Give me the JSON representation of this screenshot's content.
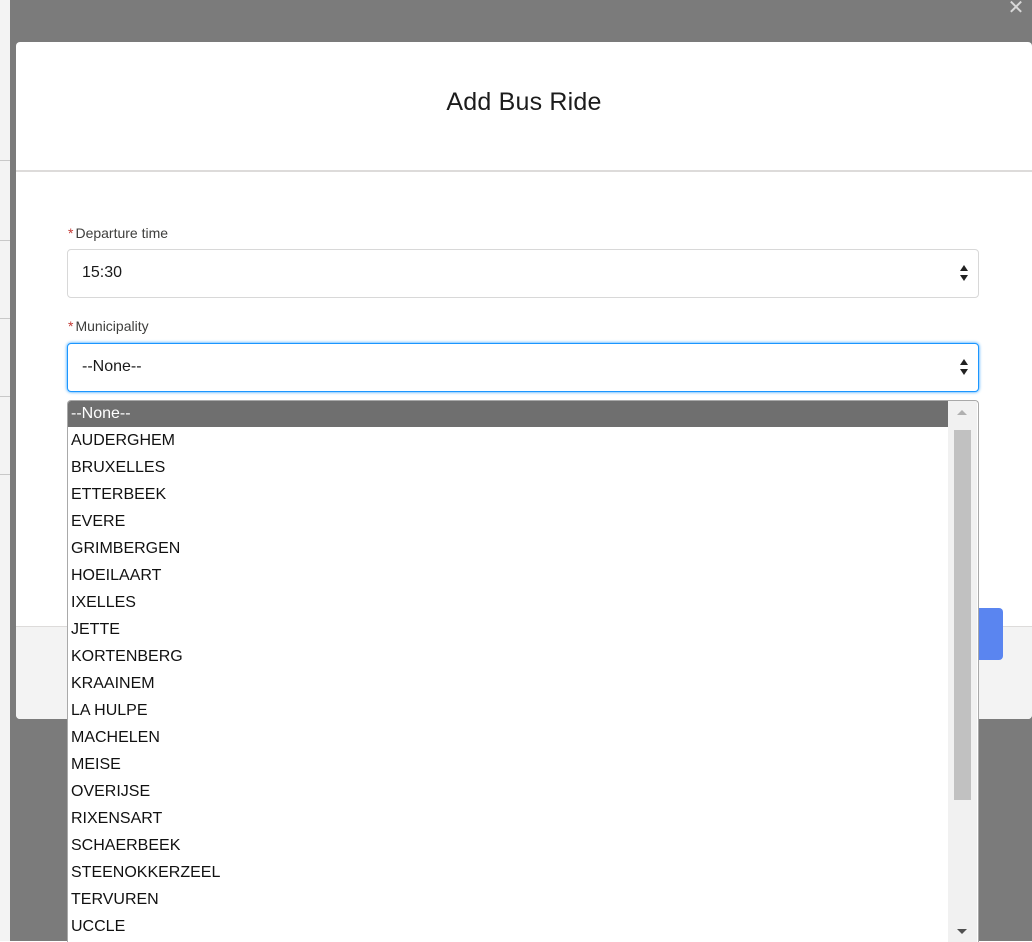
{
  "modal": {
    "title": "Add Bus Ride",
    "close_glyph": "✕"
  },
  "form": {
    "required_marker": "*",
    "departure_label": "Departure time",
    "departure_value": "15:30",
    "municipality_label": "Municipality",
    "municipality_value": "--None--"
  },
  "dropdown": {
    "selected_index": 0,
    "options": [
      "--None--",
      "AUDERGHEM",
      "BRUXELLES",
      "ETTERBEEK",
      "EVERE",
      "GRIMBERGEN",
      "HOEILAART",
      "IXELLES",
      "JETTE",
      "KORTENBERG",
      "KRAAINEM",
      "LA HULPE",
      "MACHELEN",
      "MEISE",
      "OVERIJSE",
      "RIXENSART",
      "SCHAERBEEK",
      "STEENOKKERZEEL",
      "TERVUREN",
      "UCCLE"
    ]
  },
  "colors": {
    "accent": "#1b96ff",
    "required": "#c23934",
    "selected_option_bg": "#6f6f6f",
    "backdrop": "#7b7b7b",
    "button": "#5a85f0"
  },
  "icons": {
    "close": "close-icon",
    "spinner": "spinner-arrows-icon",
    "scroll_up": "scroll-up-arrow-icon",
    "scroll_down": "scroll-down-arrow-icon"
  }
}
